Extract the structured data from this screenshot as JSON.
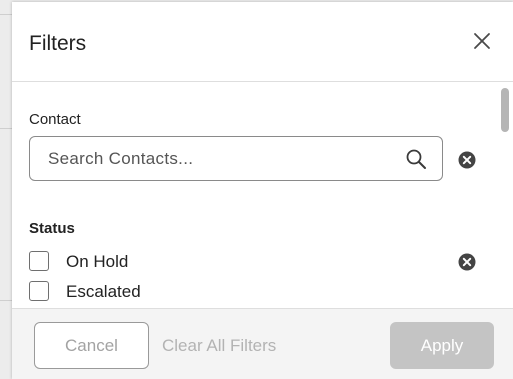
{
  "dialog": {
    "title": "Filters"
  },
  "contact": {
    "label": "Contact",
    "search_value": "",
    "search_placeholder": "Search Contacts..."
  },
  "status": {
    "label": "Status",
    "options": [
      {
        "label": "On Hold",
        "checked": false
      },
      {
        "label": "Escalated",
        "checked": false
      }
    ]
  },
  "footer": {
    "cancel_label": "Cancel",
    "clear_all_label": "Clear All Filters",
    "apply_label": "Apply"
  },
  "icons": {
    "close": "close-icon",
    "search": "search-icon",
    "clear": "clear-circle-icon"
  },
  "colors": {
    "apply_disabled_bg": "#c4c4c4",
    "disabled_text": "#a3a3a3",
    "footer_bg": "#f4f4f4"
  }
}
